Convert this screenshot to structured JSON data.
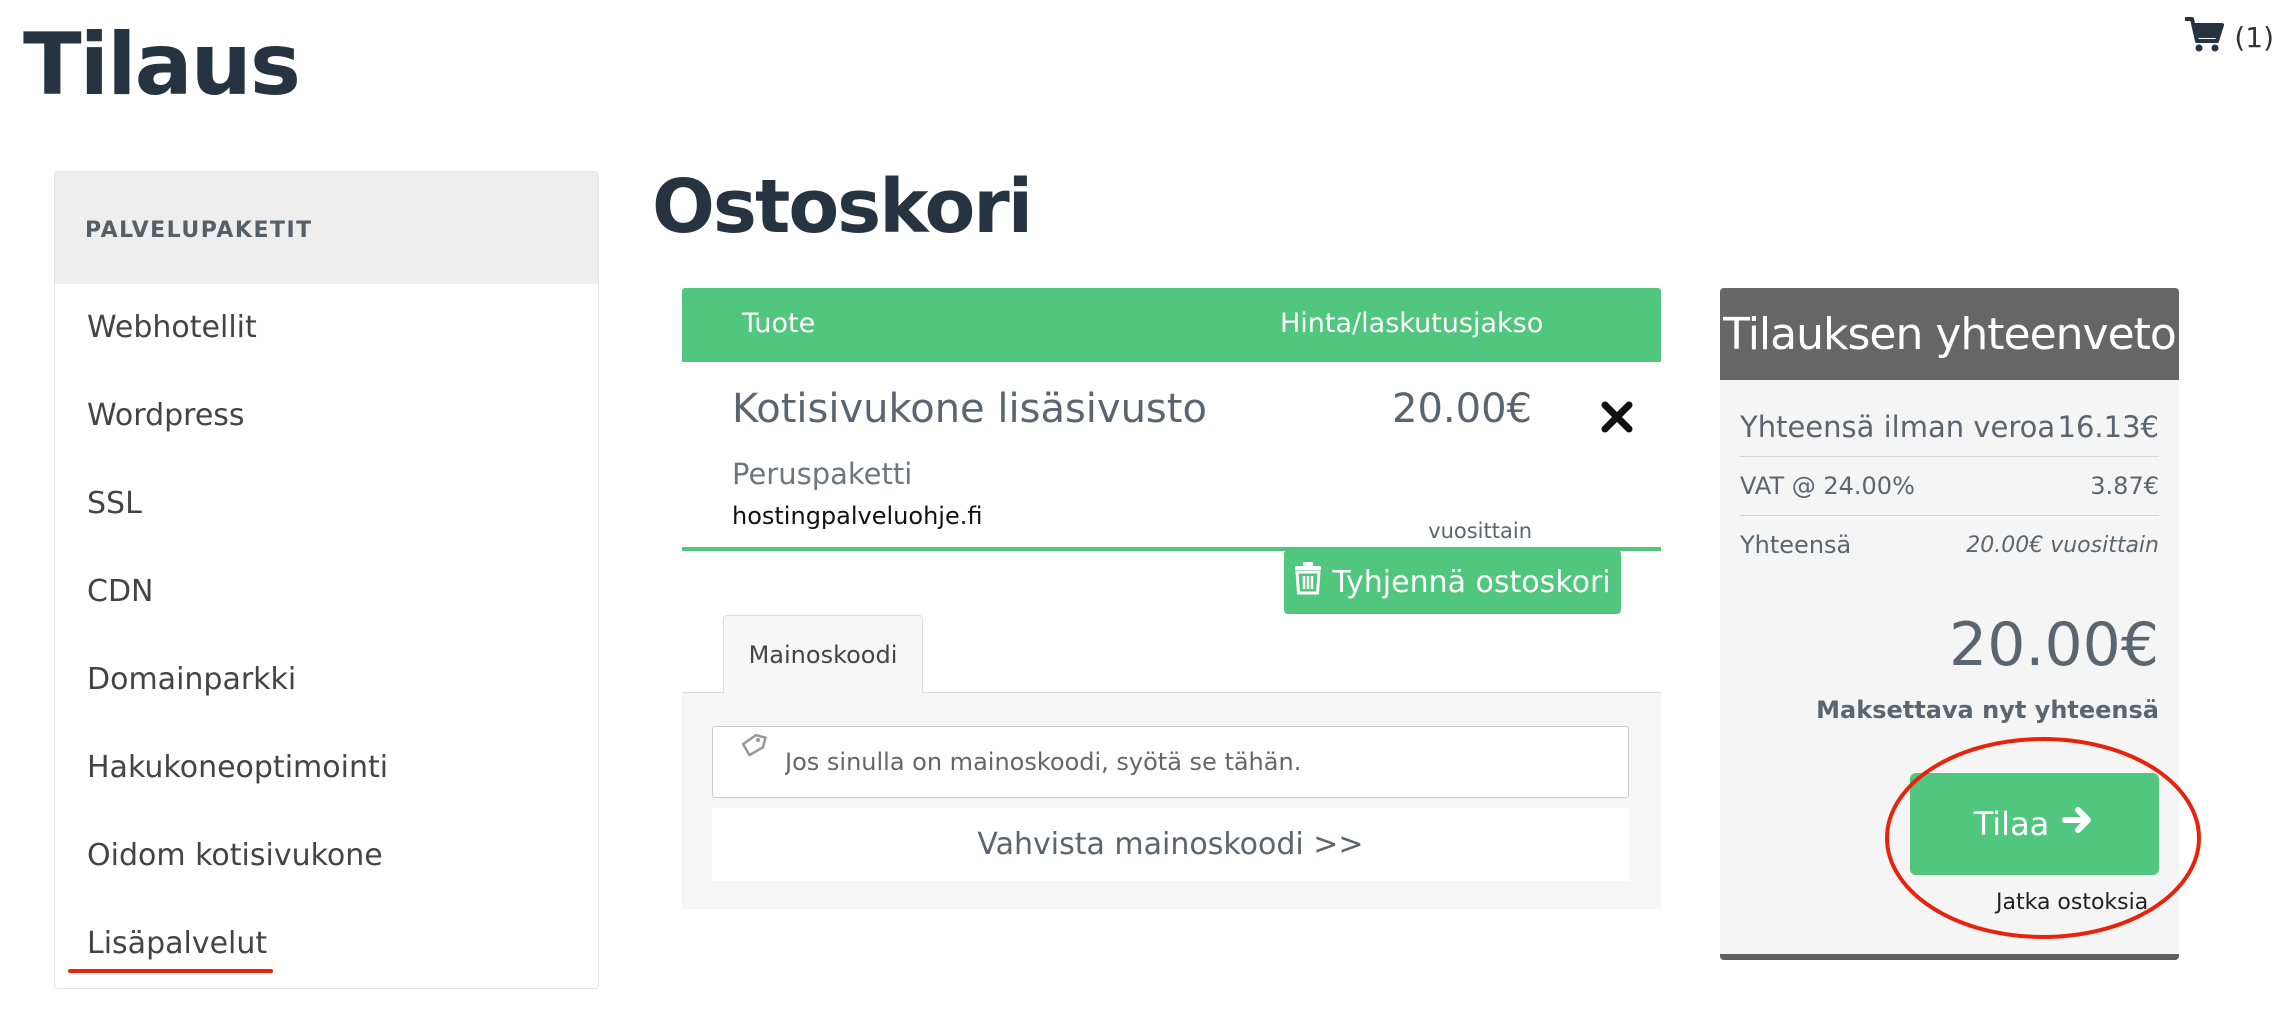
{
  "header": {
    "title": "Tilaus",
    "cart_icon": "shopping-cart-icon",
    "cart_count": "(1)"
  },
  "sidebar": {
    "heading": "PALVELUPAKETIT",
    "items": [
      {
        "label": "Webhotellit"
      },
      {
        "label": "Wordpress"
      },
      {
        "label": "SSL"
      },
      {
        "label": "CDN"
      },
      {
        "label": "Domainparkki"
      },
      {
        "label": "Hakukoneoptimointi"
      },
      {
        "label": "Oidom kotisivukone"
      },
      {
        "label": "Lisäpalvelut"
      }
    ],
    "highlighted_item": "Lisäpalvelut",
    "highlight_color": "#e8230c"
  },
  "main": {
    "heading": "Ostoskori",
    "table": {
      "col_product": "Tuote",
      "col_price": "Hinta/laskutusjakso"
    },
    "item": {
      "name": "Kotisivukone lisäsivusto",
      "package": "Peruspaketti",
      "domain": "hostingpalveluohje.fi",
      "price": "20.00€",
      "cycle": "vuosittain",
      "remove_icon": "close-icon"
    },
    "empty_cart_label": "Tyhjennä ostoskori",
    "empty_cart_icon": "trash-icon",
    "promo": {
      "tab_label": "Mainoskoodi",
      "placeholder": "Jos sinulla on mainoskoodi, syötä se tähän.",
      "icon": "tag-icon",
      "validate_label": "Vahvista mainoskoodi >>"
    }
  },
  "summary": {
    "title": "Tilauksen yhteenveto",
    "subtotal_label": "Yhteensä ilman veroa",
    "subtotal_value": "16.13€",
    "vat_label": "VAT @ 24.00%",
    "vat_value": "3.87€",
    "total_label": "Yhteensä",
    "total_cycle": "20.00€ vuosittain",
    "big_total": "20.00€",
    "due_label": "Maksettava nyt yhteensä",
    "order_label": "Tilaa",
    "order_icon": "arrow-right-icon",
    "continue_label": "Jatka ostoksia"
  },
  "colors": {
    "accent_green": "#50c67e",
    "heading_dark": "#263340",
    "summary_header": "#666666",
    "annotation_red": "#e8230c"
  }
}
